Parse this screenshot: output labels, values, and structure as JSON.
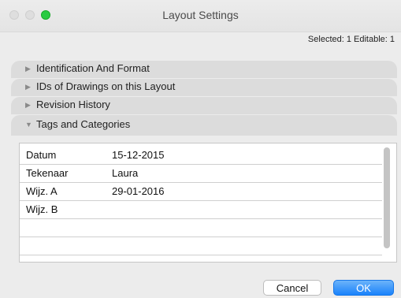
{
  "window": {
    "title": "Layout Settings"
  },
  "selection_info": "Selected: 1 Editable: 1",
  "sections": [
    {
      "label": "Identification And Format",
      "expanded": false
    },
    {
      "label": "IDs of Drawings on this Layout",
      "expanded": false
    },
    {
      "label": "Revision History",
      "expanded": false
    },
    {
      "label": "Tags and Categories",
      "expanded": true
    }
  ],
  "tags_table": {
    "rows": [
      {
        "key": "Datum",
        "value": "15-12-2015"
      },
      {
        "key": "Tekenaar",
        "value": "Laura"
      },
      {
        "key": "Wijz. A",
        "value": "29-01-2016"
      },
      {
        "key": "Wijz. B",
        "value": ""
      }
    ]
  },
  "buttons": {
    "cancel": "Cancel",
    "ok": "OK"
  },
  "icons": {
    "collapsed": "disclosure-right-icon",
    "expanded": "disclosure-down-icon"
  }
}
